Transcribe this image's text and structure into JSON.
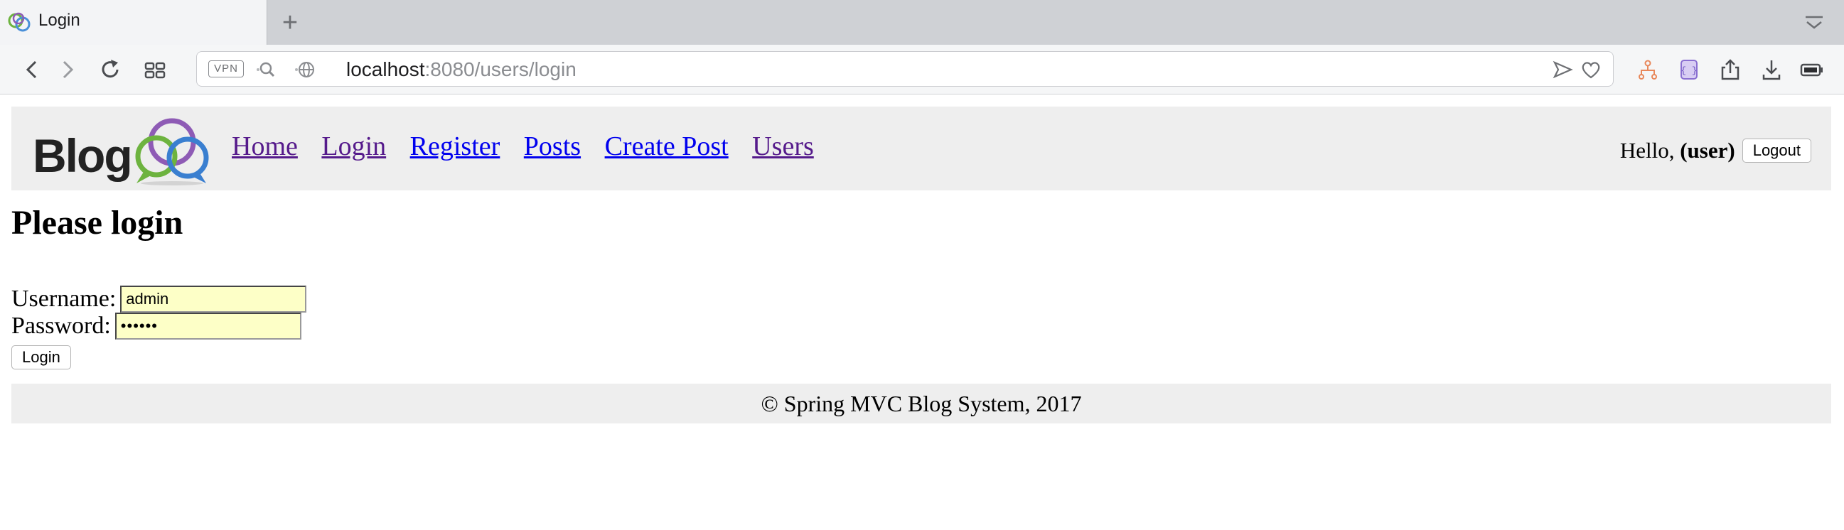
{
  "browser": {
    "tab": {
      "title": "Login"
    },
    "address": {
      "vpn_label": "VPN",
      "host": "localhost",
      "path": ":8080/users/login"
    },
    "icons": [
      "back-icon",
      "forward-icon",
      "reload-icon",
      "speed-dial-icon",
      "send-icon",
      "heart-icon",
      "sitemap-icon",
      "extension-icon",
      "share-icon",
      "download-icon",
      "battery-icon"
    ]
  },
  "header": {
    "nav": [
      "Home",
      "Login",
      "Register",
      "Posts",
      "Create Post",
      "Users"
    ],
    "greeting": "Hello, ",
    "username": "(user)",
    "logout_label": "Logout",
    "logo_text": "Blog"
  },
  "main": {
    "title": "Please login",
    "username_label": "Username:",
    "username_value": "admin",
    "password_label": "Password:",
    "password_value": "••••••",
    "login_button": "Login"
  },
  "footer": {
    "text": "© Spring MVC Blog System, 2017"
  },
  "colors": {
    "link": "#0000ee",
    "visited": "#551a8b",
    "header_bg": "#eeeeee",
    "input_bg": "#fdffc7"
  }
}
